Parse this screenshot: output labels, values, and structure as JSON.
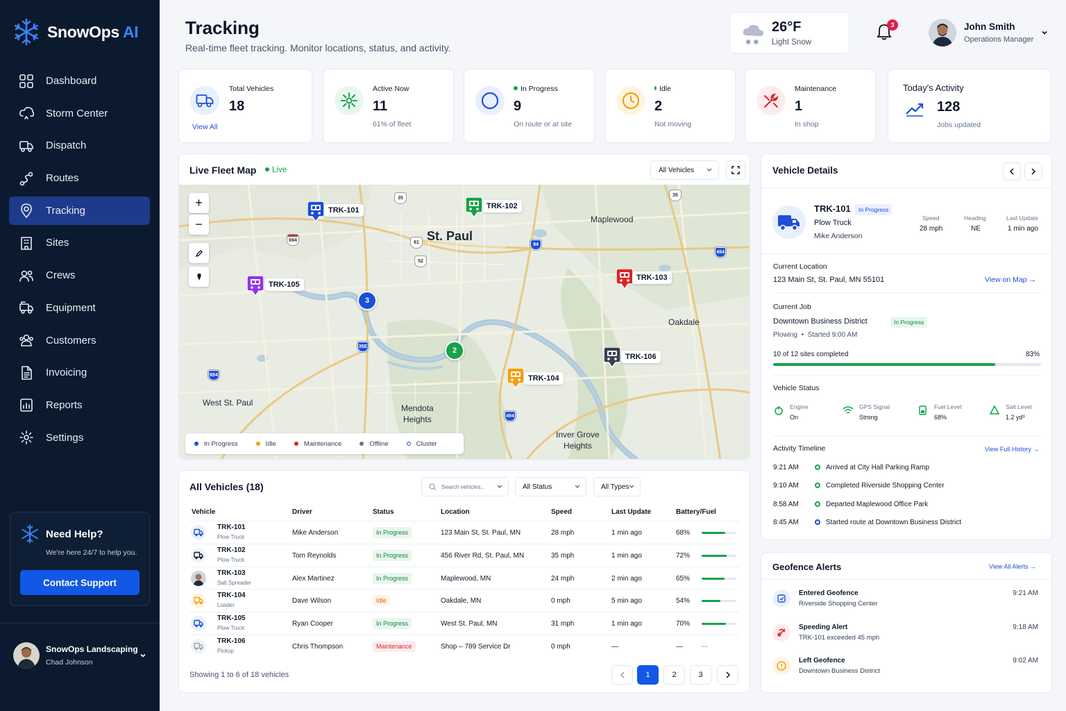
{
  "brand": {
    "name": "SnowOps",
    "suffix": "AI"
  },
  "nav": [
    {
      "label": "Dashboard",
      "icon": "grid-icon"
    },
    {
      "label": "Storm Center",
      "icon": "cloud-icon"
    },
    {
      "label": "Dispatch",
      "icon": "truck-icon"
    },
    {
      "label": "Routes",
      "icon": "route-icon"
    },
    {
      "label": "Tracking",
      "icon": "location-pin-icon",
      "active": true
    },
    {
      "label": "Sites",
      "icon": "building-icon"
    },
    {
      "label": "Crews",
      "icon": "users-icon"
    },
    {
      "label": "Equipment",
      "icon": "equipment-truck-icon"
    },
    {
      "label": "Customers",
      "icon": "customers-icon"
    },
    {
      "label": "Invoicing",
      "icon": "document-icon"
    },
    {
      "label": "Reports",
      "icon": "reports-icon"
    },
    {
      "label": "Settings",
      "icon": "gear-icon"
    }
  ],
  "help": {
    "title": "Need Help?",
    "text": "We're here 24/7 to help you.",
    "button": "Contact Support"
  },
  "org": {
    "name": "SnowOps Landscaping",
    "user": "Chad Johnson"
  },
  "header": {
    "title": "Tracking",
    "subtitle": "Real-time fleet tracking. Monitor locations, status, and activity."
  },
  "weather": {
    "temp": "26°F",
    "desc": "Light Snow"
  },
  "notifications": {
    "count": "3"
  },
  "user": {
    "name": "John Smith",
    "role": "Operations Manager"
  },
  "stats": [
    {
      "label": "Total Vehicles",
      "value": "18",
      "sub": "View All"
    },
    {
      "label": "Active Now",
      "value": "11",
      "sub": "61% of fleet"
    },
    {
      "label": "In Progress",
      "value": "9",
      "sub": "On route or at site"
    },
    {
      "label": "Idle",
      "value": "2",
      "sub": "Not moving"
    },
    {
      "label": "Maintenance",
      "value": "1",
      "sub": "In shop"
    },
    {
      "label": "Today's Activity",
      "value": "128",
      "sub": "Jobs updated"
    }
  ],
  "map": {
    "title": "Live Fleet Map",
    "live": "Live",
    "filter": "All Vehicles",
    "cities": [
      "St. Paul",
      "Maplewood",
      "Oakdale",
      "West St. Paul",
      "Mendota\nHeights",
      "Inver Grove\nHeights"
    ],
    "pins": [
      "TRK-101",
      "TRK-102",
      "TRK-103",
      "TRK-104",
      "TRK-105",
      "TRK-106"
    ],
    "clusters": [
      "3",
      "2"
    ],
    "legend": [
      "In Progress",
      "Idle",
      "Maintenance",
      "Offline",
      "Cluster"
    ],
    "routes": [
      "35",
      "694",
      "61",
      "94",
      "52",
      "494",
      "35E",
      "5"
    ]
  },
  "table": {
    "title": "All Vehicles (18)",
    "search_placeholder": "Search vehicles...",
    "status_filter": "All Status",
    "type_filter": "All Types",
    "columns": [
      "Vehicle",
      "Driver",
      "Status",
      "Location",
      "Speed",
      "Last Update",
      "Battery/Fuel"
    ],
    "rows": [
      {
        "id": "TRK-101",
        "type": "Plow Truck",
        "driver": "Mike Anderson",
        "status": "In Progress",
        "location": "123 Main St, St. Paul, MN",
        "speed": "28 mph",
        "update": "1 min ago",
        "fuel": "68%",
        "fuel_level": 0.68
      },
      {
        "id": "TRK-102",
        "type": "Plow Truck",
        "driver": "Tom Reynolds",
        "status": "In Progress",
        "location": "456 River Rd, St. Paul, MN",
        "speed": "35 mph",
        "update": "1 min ago",
        "fuel": "72%",
        "fuel_level": 0.72
      },
      {
        "id": "TRK-103",
        "type": "Salt Spreader",
        "driver": "Alex Martinez",
        "status": "In Progress",
        "location": "Maplewood, MN",
        "speed": "24 mph",
        "update": "2 min ago",
        "fuel": "65%",
        "fuel_level": 0.65
      },
      {
        "id": "TRK-104",
        "type": "Loader",
        "driver": "Dave Wilson",
        "status": "Idle",
        "location": "Oakdale, MN",
        "speed": "0 mph",
        "update": "5 min ago",
        "fuel": "54%",
        "fuel_level": 0.54
      },
      {
        "id": "TRK-105",
        "type": "Plow Truck",
        "driver": "Ryan Cooper",
        "status": "In Progress",
        "location": "West St. Paul, MN",
        "speed": "31 mph",
        "update": "1 min ago",
        "fuel": "70%",
        "fuel_level": 0.7
      },
      {
        "id": "TRK-106",
        "type": "Pickup",
        "driver": "Chris Thompson",
        "status": "Maintenance",
        "location": "Shop – 789 Service Dr",
        "speed": "0 mph",
        "update": "—",
        "fuel": "—",
        "fuel_level": 0
      }
    ],
    "footer": "Showing 1 to 6 of 18 vehicles",
    "pages": [
      "1",
      "2",
      "3"
    ]
  },
  "vehicle": {
    "title": "Vehicle Details",
    "id": "TRK-101",
    "status": "In Progress",
    "type": "Plow Truck",
    "driver": "Mike Anderson",
    "speed_label": "Speed",
    "speed": "28 mph",
    "heading_label": "Heading",
    "heading": "NE",
    "update_label": "Last Update",
    "update": "1 min ago",
    "location_label": "Current Location",
    "location": "123 Main St, St. Paul, MN 55101",
    "view_map": "View on Map",
    "job_label": "Current Job",
    "job": "Downtown Business District",
    "job_status": "In Progress",
    "job_type": "Plowing",
    "job_started": "Started 9:00 AM",
    "progress_text": "10 of 12 sites completed",
    "progress_pct": "83%",
    "progress": 0.83,
    "status_label": "Vehicle Status",
    "statuses": [
      {
        "label": "Engine",
        "value": "On"
      },
      {
        "label": "GPS Signal",
        "value": "Strong"
      },
      {
        "label": "Fuel Level",
        "value": "68%"
      },
      {
        "label": "Salt Level",
        "value": "1.2 yd³"
      }
    ],
    "timeline_label": "Activity Timeline",
    "timeline_link": "View Full History",
    "timeline": [
      {
        "time": "9:21 AM",
        "text": "Arrived at City Hall Parking Ramp"
      },
      {
        "time": "9:10 AM",
        "text": "Completed Riverside Shopping Center"
      },
      {
        "time": "8:58 AM",
        "text": "Departed Maplewood Office Park"
      },
      {
        "time": "8:45 AM",
        "text": "Started route at Downtown Business District"
      }
    ]
  },
  "geofence": {
    "title": "Geofence Alerts",
    "link": "View All Alerts",
    "alerts": [
      {
        "title": "Entered Geofence",
        "text": "Riverside Shopping Center",
        "time": "9:21 AM"
      },
      {
        "title": "Speeding Alert",
        "text": "TRK-101 exceeded 45 mph",
        "time": "9:18 AM"
      },
      {
        "title": "Left Geofence",
        "text": "Downtown Business District",
        "time": "9:02 AM"
      }
    ]
  },
  "colors": {
    "accent": "#1158e6",
    "sidebar": "#0b1a2e",
    "progress": "#16a34a",
    "idle": "#f59e0b",
    "maintenance": "#dc2626"
  }
}
